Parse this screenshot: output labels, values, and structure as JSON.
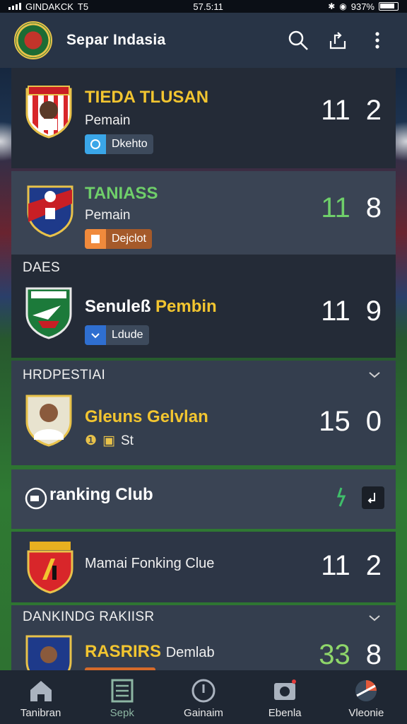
{
  "status_bar": {
    "carrier": "GINDAKCK",
    "signal_extra": "T5",
    "time": "57.5:11",
    "battery": "937%"
  },
  "app_bar": {
    "title": "Separ Indasia",
    "icons": [
      "search-icon",
      "share-icon",
      "more-vert-icon"
    ]
  },
  "colors": {
    "app_bar": "#283446",
    "card": "#2d3646",
    "yellow": "#f2c530",
    "green": "#6fcf6a",
    "nav_bar": "#1f2733"
  },
  "matches": [
    {
      "team": "TIEDA TLUSAN",
      "team_color": "#f2c530",
      "label": "Pemain",
      "chip": "Dkehto",
      "chip_color": "#3d4a5c",
      "chip_icon_color": "#3aa6e8",
      "score_left": "11",
      "score_right": "2"
    },
    {
      "team": "TANIASS",
      "team_color": "#6fcf6a",
      "label": "Pemain",
      "chip": "Dejclot",
      "chip_color": "#a55a2a",
      "chip_icon_color": "#f08a3c",
      "score_left": "11",
      "score_right": "8"
    },
    {
      "section": "DAES",
      "team_prefix": "Senuleß",
      "team_suffix": "Pembin",
      "chip": "Ldude",
      "chip_color": "#3d4a5c",
      "chip_icon_color": "#2f6fd0",
      "score_left": "11",
      "score_right": "9"
    },
    {
      "section": "HRDPESTIAI",
      "team": "Gleuns Gelvlan",
      "team_color": "#f2c530",
      "label": "St",
      "score_left": "15",
      "score_right": "0"
    },
    {
      "ranking_title": "ranking Club"
    },
    {
      "team": "Mamai Fonking Clue",
      "team_color": "#f0f0f0",
      "score_left": "11",
      "score_right": "2"
    },
    {
      "section": "DANKINDG RAKIISR",
      "team_prefix": "RASRIRS",
      "team_suffix": "Demlab",
      "score_left": "33",
      "score_right": "8",
      "score_left_color": "#8fd66a"
    }
  ],
  "nav": [
    {
      "label": "Tanibran",
      "icon": "home-icon"
    },
    {
      "label": "Sepk",
      "icon": "table-icon",
      "active": true
    },
    {
      "label": "Gainaim",
      "icon": "circle-icon"
    },
    {
      "label": "Ebenla",
      "icon": "camera-icon"
    },
    {
      "label": "Vleonie",
      "icon": "ball-icon"
    }
  ]
}
